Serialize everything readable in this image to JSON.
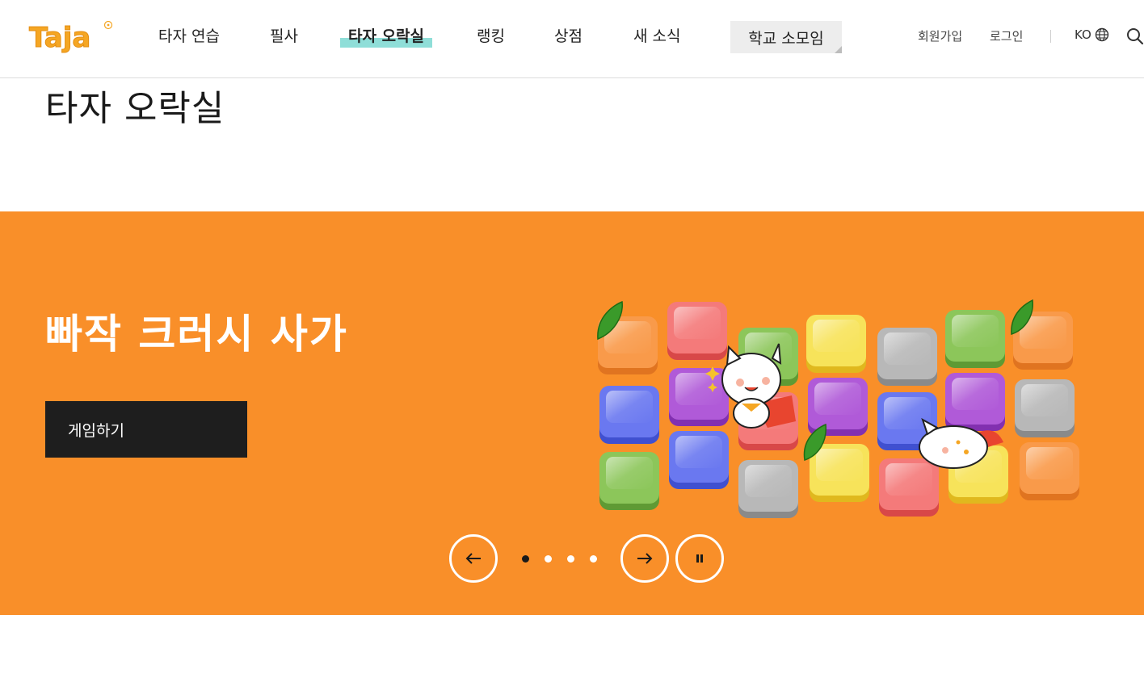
{
  "header": {
    "logo_text": "Taja",
    "nav": [
      {
        "label": "타자 연습"
      },
      {
        "label": "필사"
      },
      {
        "label": "타자 오락실"
      },
      {
        "label": "랭킹"
      },
      {
        "label": "상점"
      },
      {
        "label": "새 소식"
      }
    ],
    "school_button": "학교 소모임",
    "signup": "회원가입",
    "login": "로그인",
    "lang": "KO"
  },
  "page": {
    "title": "타자 오락실"
  },
  "banner": {
    "title": "빠작 크러시 사가",
    "play_button": "게임하기",
    "background_color": "#f98f29",
    "slide_count": 4,
    "active_slide": 1
  },
  "colors": {
    "accent_highlight": "#8fded8",
    "brand_orange": "#f98f29",
    "logo_orange": "#f5a623"
  }
}
